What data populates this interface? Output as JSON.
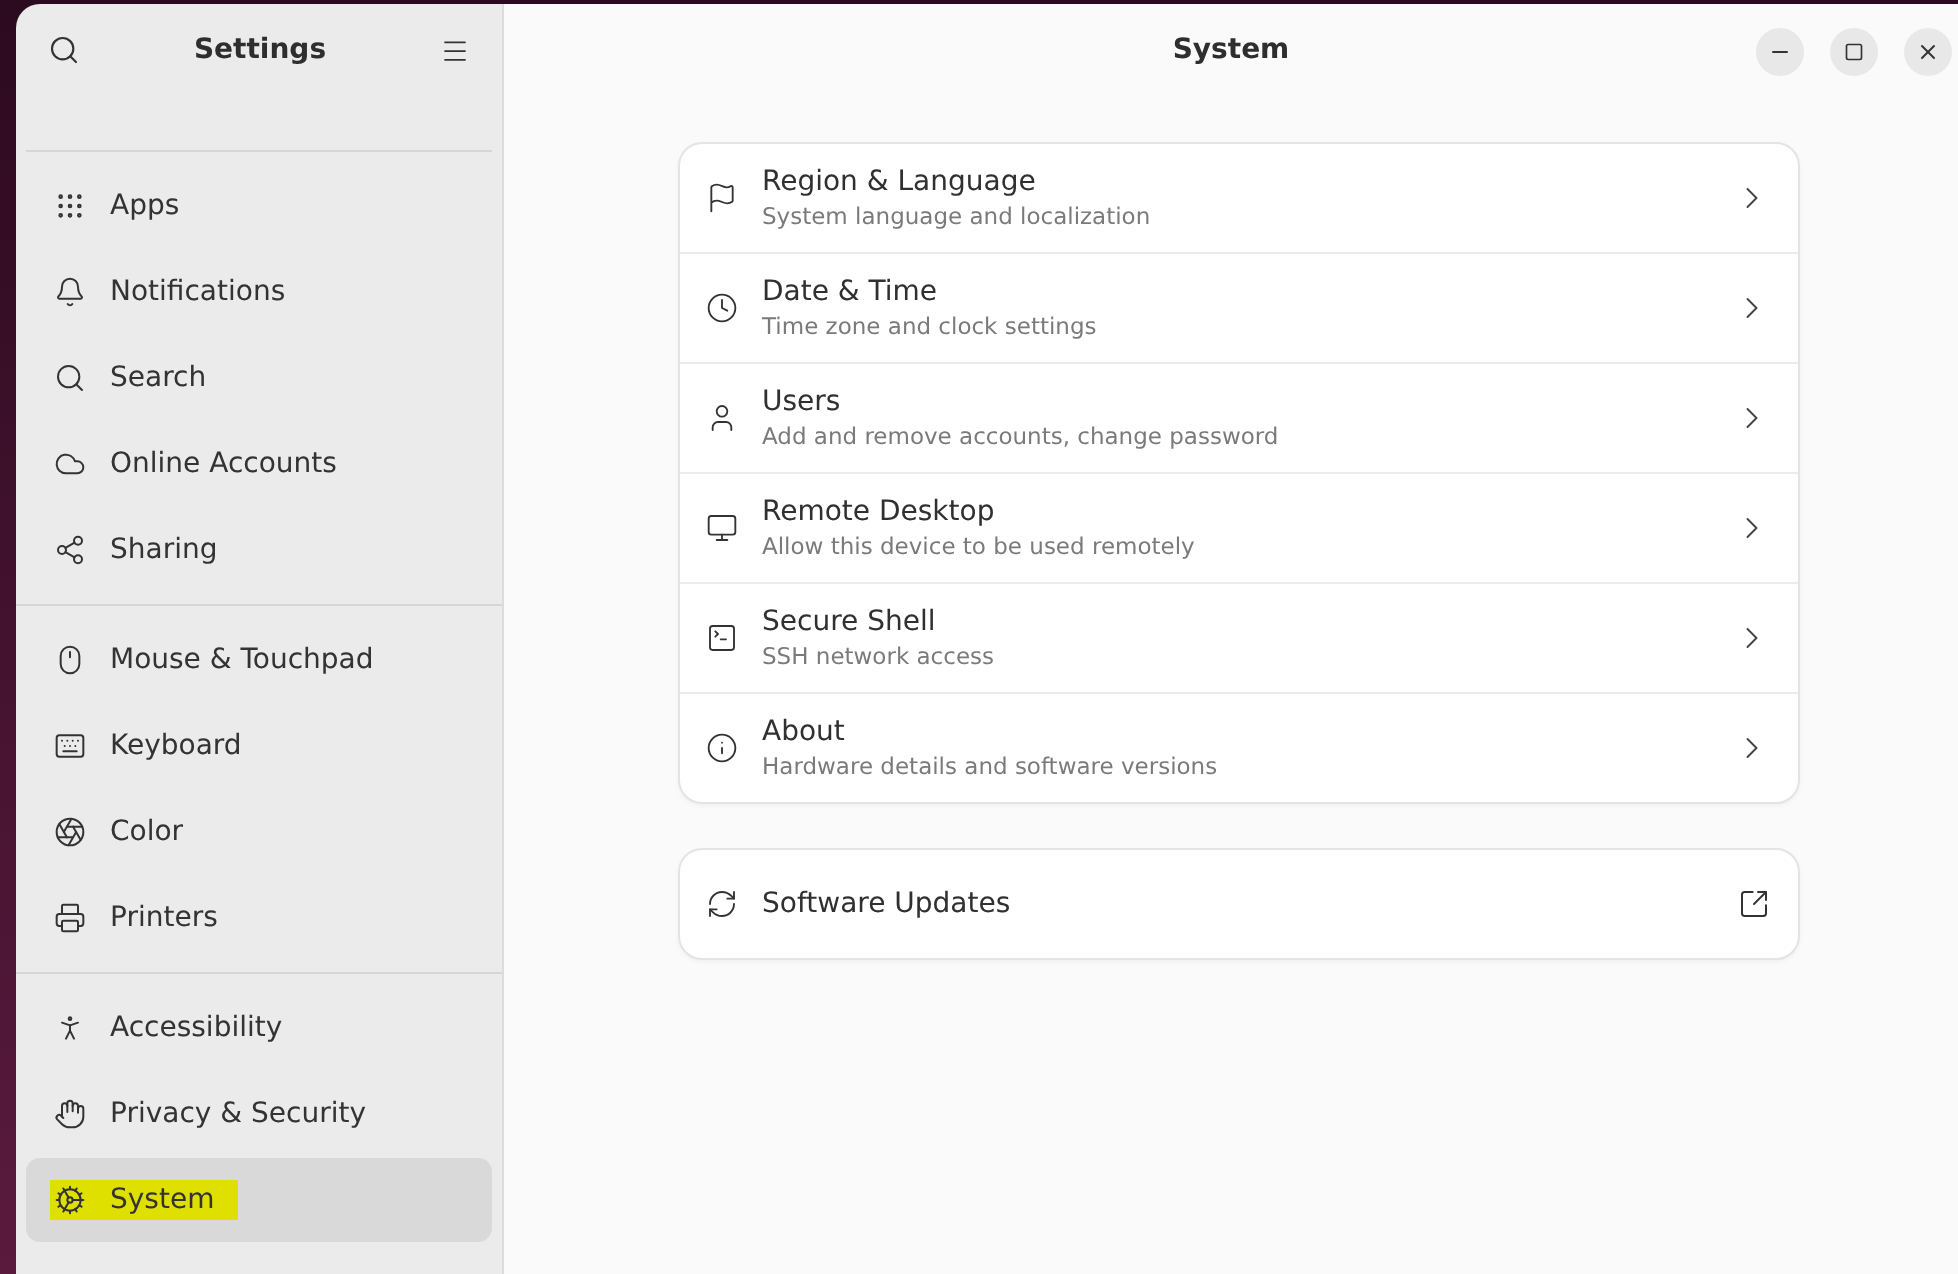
{
  "sidebar": {
    "title": "Settings",
    "groups": [
      {
        "items": [
          {
            "label": "Apps",
            "selected": false,
            "highlighted": false
          },
          {
            "label": "Notifications",
            "selected": false,
            "highlighted": false
          },
          {
            "label": "Search",
            "selected": false,
            "highlighted": false
          },
          {
            "label": "Online Accounts",
            "selected": false,
            "highlighted": false
          },
          {
            "label": "Sharing",
            "selected": false,
            "highlighted": false
          }
        ]
      },
      {
        "items": [
          {
            "label": "Mouse & Touchpad",
            "selected": false,
            "highlighted": false
          },
          {
            "label": "Keyboard",
            "selected": false,
            "highlighted": false
          },
          {
            "label": "Color",
            "selected": false,
            "highlighted": false
          },
          {
            "label": "Printers",
            "selected": false,
            "highlighted": false
          }
        ]
      },
      {
        "items": [
          {
            "label": "Accessibility",
            "selected": false,
            "highlighted": false
          },
          {
            "label": "Privacy & Security",
            "selected": false,
            "highlighted": false
          },
          {
            "label": "System",
            "selected": true,
            "highlighted": true
          }
        ]
      }
    ]
  },
  "page": {
    "title": "System",
    "rows": [
      {
        "title": "Region & Language",
        "subtitle": "System language and localization",
        "kind": "link"
      },
      {
        "title": "Date & Time",
        "subtitle": "Time zone and clock settings",
        "kind": "link"
      },
      {
        "title": "Users",
        "subtitle": "Add and remove accounts, change password",
        "kind": "link"
      },
      {
        "title": "Remote Desktop",
        "subtitle": "Allow this device to be used remotely",
        "kind": "link"
      },
      {
        "title": "Secure Shell",
        "subtitle": "SSH network access",
        "kind": "link"
      },
      {
        "title": "About",
        "subtitle": "Hardware details and software versions",
        "kind": "link"
      }
    ],
    "extra_rows": [
      {
        "title": "Software Updates",
        "kind": "external"
      }
    ]
  }
}
